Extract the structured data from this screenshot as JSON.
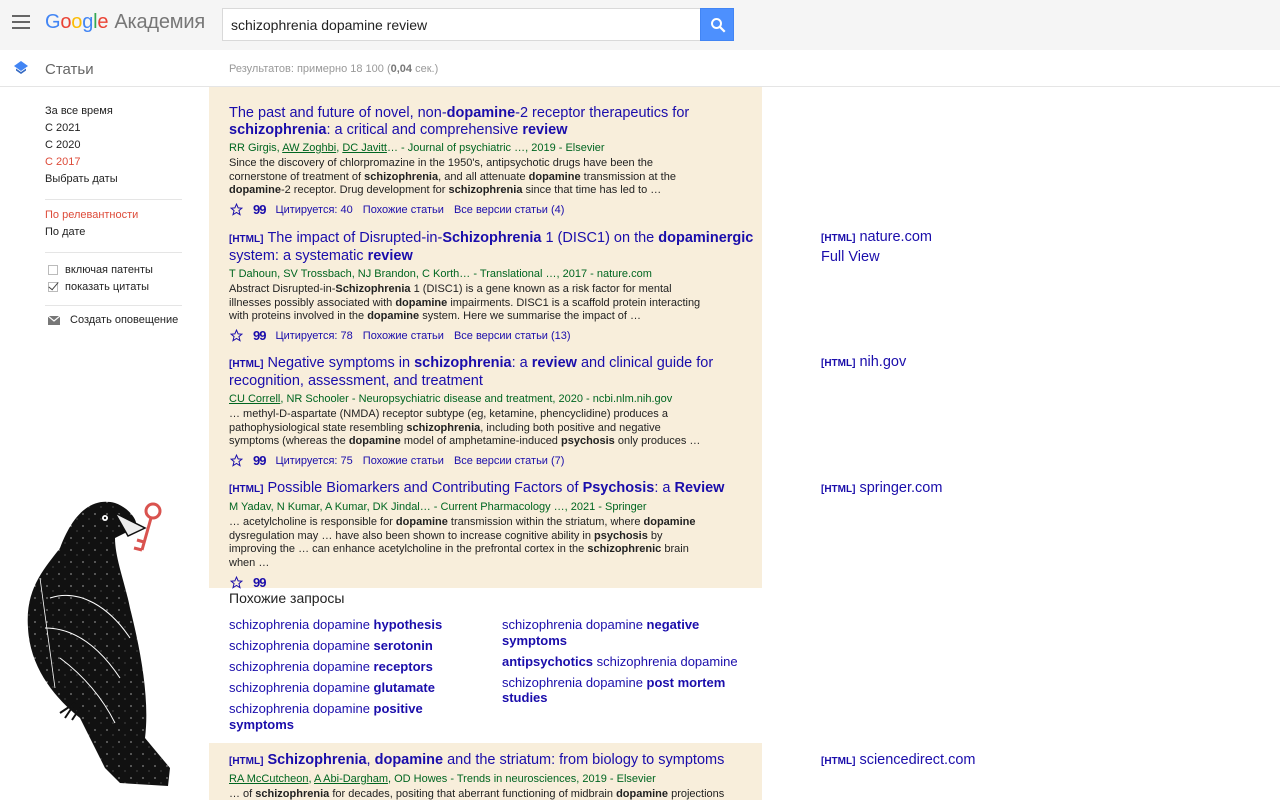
{
  "header": {
    "logo_letters": [
      "G",
      "o",
      "o",
      "g",
      "l",
      "e"
    ],
    "logo_suffix": "Академия",
    "search_value": "schizophrenia dopamine review"
  },
  "subheader": {
    "section_label": "Статьи",
    "results_prefix": "Результатов: примерно 18 100 (",
    "results_time": "0,04",
    "results_suffix": " сек.)"
  },
  "sidebar": {
    "time_filters": [
      "За все время",
      "С 2021",
      "С 2020",
      "С 2017",
      "Выбрать даты"
    ],
    "sort_options": [
      "По релевантности",
      "По дате"
    ],
    "checkbox_patents": "включая патенты",
    "checkbox_citations": "показать цитаты",
    "create_alert": "Создать оповещение"
  },
  "results": [
    {
      "title_html": "The past and future of novel, non-<b>dopamine</b>-2 receptor therapeutics for <b>schizophrenia</b>: a critical and comprehensive <b>review</b>",
      "authors_html": "RR Girgis, <u>AW Zoghbi</u>, <u>DC Javitt</u>… - Journal of psychiatric …, 2019 - Elsevier",
      "snippet_html": "Since the discovery of chlorpromazine in the 1950's, antipsychotic drugs have been the cornerstone of treatment of <b>schizophrenia</b>, and all attenuate <b>dopamine</b> transmission at the <b>dopamine</b>-2 receptor. Drug development for <b>schizophrenia</b> since that time has led to …",
      "cited": "Цитируется: 40",
      "related": "Похожие статьи",
      "versions": "Все версии статьи (4)"
    },
    {
      "tag": "[HTML]",
      "title_html": "The impact of Disrupted-in-<b>Schizophrenia</b> 1 (DISC1) on the <b>dopaminergic</b> system: a systematic <b>review</b>",
      "authors_html": "T Dahoun, SV Trossbach, NJ Brandon, C Korth… - Translational …, 2017 - nature.com",
      "snippet_html": "Abstract Disrupted-in-<b>Schizophrenia</b> 1 (DISC1) is a gene known as a risk factor for mental illnesses possibly associated with <b>dopamine</b> impairments. DISC1 is a scaffold protein interacting with proteins involved in the <b>dopamine</b> system. Here we summarise the impact of …",
      "cited": "Цитируется: 78",
      "related": "Похожие статьи",
      "versions": "Все версии статьи (13)",
      "side_tag": "[HTML]",
      "side_source": "nature.com",
      "side_extra": "Full View"
    },
    {
      "tag": "[HTML]",
      "title_html": "Negative symptoms in <b>schizophrenia</b>: a <b>review</b> and clinical guide for recognition, assessment, and treatment",
      "authors_html": "<u>CU Correll</u>, NR Schooler - Neuropsychiatric disease and treatment, 2020 - ncbi.nlm.nih.gov",
      "snippet_html": "… methyl-D-aspartate (NMDA) receptor subtype (eg, ketamine, phencyclidine) produces a pathophysiological state resembling <b>schizophrenia</b>, including both positive and negative symptoms (whereas the <b>dopamine</b> model of amphetamine-induced <b>psychosis</b> only produces …",
      "cited": "Цитируется: 75",
      "related": "Похожие статьи",
      "versions": "Все версии статьи (7)",
      "side_tag": "[HTML]",
      "side_source": "nih.gov"
    },
    {
      "tag": "[HTML]",
      "title_html": "Possible Biomarkers and Contributing Factors of <b>Psychosis</b>: a <b>Review</b>",
      "authors_html": "M Yadav, N Kumar, A Kumar, DK Jindal… - Current Pharmacology …, 2021 - Springer",
      "snippet_html": "… acetylcholine is responsible for <b>dopamine</b> transmission within the striatum, where <b>dopamine</b> dysregulation may … have also been shown to increase cognitive ability in <b>psychosis</b> by improving the … can enhance acetylcholine in the prefrontal cortex in the <b>schizophrenic</b> brain when …",
      "side_tag": "[HTML]",
      "side_source": "springer.com"
    },
    {
      "tag": "[HTML]",
      "title_html": "<b>Schizophrenia</b>, <b>dopamine</b> and the striatum: from biology to symptoms",
      "authors_html": "<u>RA McCutcheon</u>, <u>A Abi-Dargham</u>, OD Howes - Trends in neurosciences, 2019 - Elsevier",
      "snippet_html": "… of <b>schizophrenia</b> for decades, positing that aberrant functioning of midbrain <b>dopamine</b> projections",
      "side_tag": "[HTML]",
      "side_source": "sciencedirect.com"
    }
  ],
  "related_searches": {
    "title": "Похожие запросы",
    "left": [
      "schizophrenia dopamine <b>hypothesis</b>",
      "schizophrenia dopamine <b>serotonin</b>",
      "schizophrenia dopamine <b>receptors</b>",
      "schizophrenia dopamine <b>glutamate</b>",
      "schizophrenia dopamine <b>positive symptoms</b>"
    ],
    "right": [
      "schizophrenia dopamine <b>negative symptoms</b>",
      "<b>antipsychotics</b> schizophrenia dopamine",
      "schizophrenia dopamine <b>post mortem studies</b>"
    ]
  },
  "icons": {
    "menu": "menu-icon",
    "search": "search-icon",
    "articles": "scholar-cap-icon",
    "alert": "envelope-icon",
    "star": "star-icon",
    "cite": "quote-icon",
    "decoration": "crow-with-key-illustration"
  },
  "colors": {
    "link": "#1a0dab",
    "authors": "#006621",
    "active_filter": "#dd4b39",
    "highlight_bg": "#f8eedb",
    "search_button": "#4d90fe"
  }
}
